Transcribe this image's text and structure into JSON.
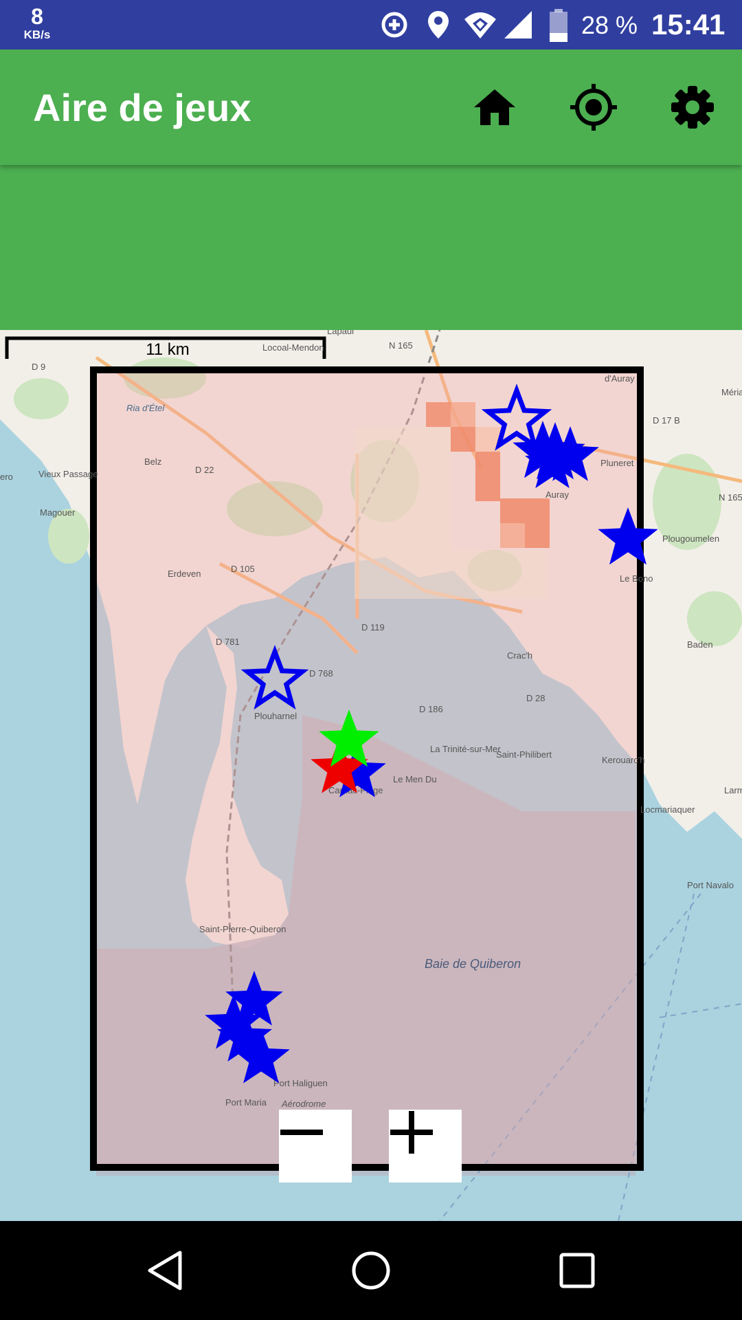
{
  "status_bar": {
    "net_speed_value": "8",
    "net_speed_unit": "KB/s",
    "battery": "28 %",
    "time": "15:41",
    "icons": [
      "data-saver-icon",
      "location-icon",
      "wifi-icon",
      "signal-icon",
      "battery-icon"
    ]
  },
  "app_bar": {
    "title": "Aire de jeux",
    "actions": [
      "home-icon",
      "my-location-icon",
      "settings-icon"
    ]
  },
  "map": {
    "scale_label": "11 km",
    "place_labels": {
      "lapaul": "Lapaul",
      "locoal": "Locoal-Mendon",
      "n165": "N 165",
      "n165b": "N 165",
      "d9": "D 9",
      "daur": "d'Auray",
      "meria": "Méria",
      "riag": "Ria d'Étel",
      "d17b": "D 17 B",
      "belz": "Belz",
      "d22": "D 22",
      "pluneret": "Pluneret",
      "vieuxpassage": "Vieux Passage",
      "ero": "ero",
      "auray": "Auray",
      "magouer": "Magouer",
      "plougoumelen": "Plougoumelen",
      "erdeven": "Erdeven",
      "d105": "D 105",
      "lebono": "Le Bono",
      "d119": "D 119",
      "d781": "D 781",
      "baden": "Baden",
      "crach": "Crac'h",
      "d768": "D 768",
      "d28": "D 28",
      "plouharnel": "Plouharnel",
      "d186": "D 186",
      "latrinite": "La Trinité-sur-Mer",
      "saintphilibert": "Saint-Philibert",
      "kerouarch": "Kerouarc'h",
      "lemendu": "Le Men Du",
      "carnac": "Carnac-Plage",
      "locmariaquer": "Locmariaquer",
      "portnavalo": "Port Navalo",
      "stpierre": "Saint-Pierre-Quiberon",
      "baie": "Baie de Quiberon",
      "porthaliguen": "Port Haliguen",
      "portmaria": "Port Maria",
      "aerodrome": "Aérodrome",
      "larm": "Larm"
    },
    "markers": [
      {
        "kind": "outline-star",
        "color": "#0000EE"
      },
      {
        "kind": "filled-star",
        "color": "#0000EE"
      },
      {
        "kind": "filled-star",
        "color": "#00EE00"
      },
      {
        "kind": "filled-star",
        "color": "#EE0000"
      }
    ],
    "zoom_out_icon": "minus-icon",
    "zoom_in_icon": "plus-icon"
  },
  "nav_bar": {
    "buttons": [
      "back-icon",
      "home-circle-icon",
      "recents-icon"
    ]
  },
  "colors": {
    "status_bar": "#303F9F",
    "app_bar": "#4CAF50",
    "sea": "#AAD3DF",
    "land": "#F2EFE9",
    "marker_blue": "#0000EE",
    "marker_green": "#00EE00",
    "marker_red": "#EE0000"
  }
}
